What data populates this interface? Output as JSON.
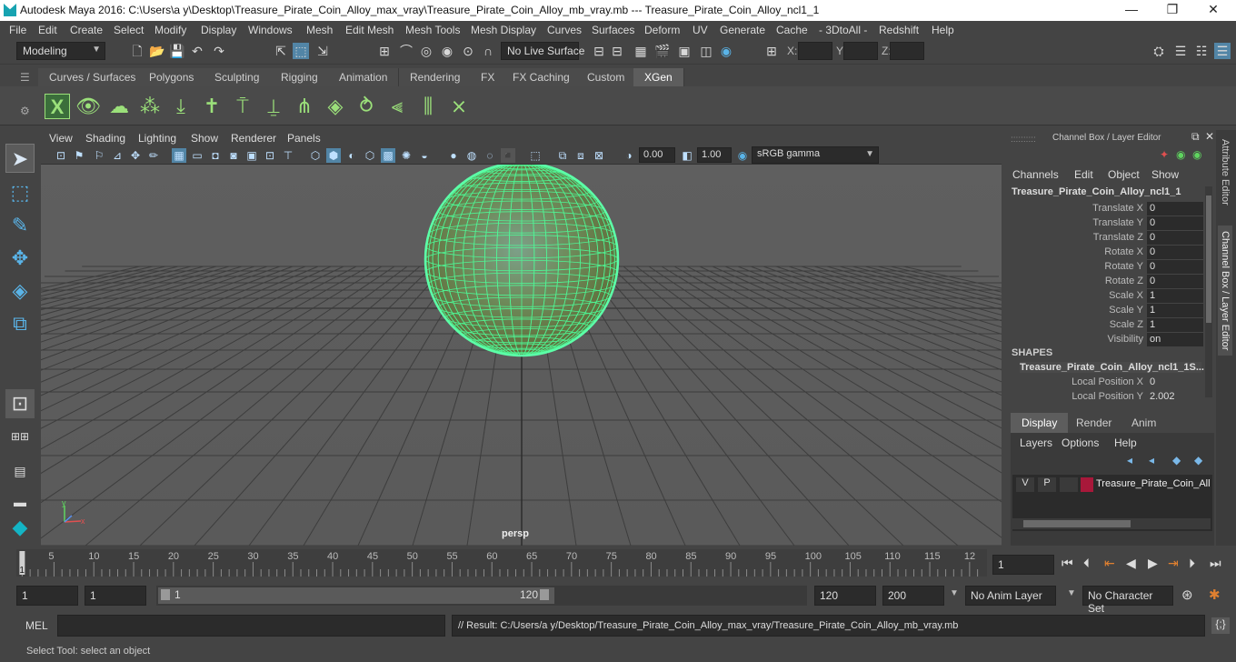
{
  "window": {
    "title": "Autodesk Maya 2016: C:\\Users\\a y\\Desktop\\Treasure_Pirate_Coin_Alloy_max_vray\\Treasure_Pirate_Coin_Alloy_mb_vray.mb   ---   Treasure_Pirate_Coin_Alloy_ncl1_1",
    "minimize": "—",
    "maximize": "❐",
    "close": "✕"
  },
  "menu": [
    "File",
    "Edit",
    "Create",
    "Select",
    "Modify",
    "Display",
    "Windows",
    "Mesh",
    "Edit Mesh",
    "Mesh Tools",
    "Mesh Display",
    "Curves",
    "Surfaces",
    "Deform",
    "UV",
    "Generate",
    "Cache",
    "- 3DtoAll -",
    "Redshift",
    "Help"
  ],
  "status": {
    "mode": "Modeling",
    "live_surface": "No Live Surface",
    "x_label": "X:",
    "y_label": "Y:",
    "z_label": "Z:"
  },
  "shelf_tabs": [
    "Curves / Surfaces",
    "Polygons",
    "Sculpting",
    "Rigging",
    "Animation",
    "Rendering",
    "FX",
    "FX Caching",
    "Custom",
    "XGen"
  ],
  "panel_menu": [
    "View",
    "Shading",
    "Lighting",
    "Show",
    "Renderer",
    "Panels"
  ],
  "panel_toolbar": {
    "exposure": "0.00",
    "gamma": "1.00",
    "colorspace": "sRGB gamma"
  },
  "viewport": {
    "camera": "persp"
  },
  "channel_box": {
    "header": "Channel Box / Layer Editor",
    "menus": [
      "Channels",
      "Edit",
      "Object",
      "Show"
    ],
    "object_name": "Treasure_Pirate_Coin_Alloy_ncl1_1",
    "attributes": [
      {
        "label": "Translate X",
        "value": "0"
      },
      {
        "label": "Translate Y",
        "value": "0"
      },
      {
        "label": "Translate Z",
        "value": "0"
      },
      {
        "label": "Rotate X",
        "value": "0"
      },
      {
        "label": "Rotate Y",
        "value": "0"
      },
      {
        "label": "Rotate Z",
        "value": "0"
      },
      {
        "label": "Scale X",
        "value": "1"
      },
      {
        "label": "Scale Y",
        "value": "1"
      },
      {
        "label": "Scale Z",
        "value": "1"
      },
      {
        "label": "Visibility",
        "value": "on"
      }
    ],
    "shapes_label": "SHAPES",
    "shape_name": "Treasure_Pirate_Coin_Alloy_ncl1_1S...",
    "shape_attributes": [
      {
        "label": "Local Position X",
        "value": "0"
      },
      {
        "label": "Local Position Y",
        "value": "2.002"
      }
    ]
  },
  "side_tabs": {
    "attribute_editor": "Attribute Editor",
    "channel_box": "Channel Box / Layer Editor"
  },
  "layer_editor": {
    "tabs": [
      "Display",
      "Render",
      "Anim"
    ],
    "menus": [
      "Layers",
      "Options",
      "Help"
    ],
    "layer": {
      "v": "V",
      "p": "P",
      "name": "Treasure_Pirate_Coin_All",
      "color": "#a8183a"
    }
  },
  "timeline": {
    "ticks": [
      "5",
      "10",
      "15",
      "20",
      "25",
      "30",
      "35",
      "40",
      "45",
      "50",
      "55",
      "60",
      "65",
      "70",
      "75",
      "80",
      "85",
      "90",
      "95",
      "100",
      "105",
      "110",
      "115",
      "12"
    ],
    "current_frame_marker": "1",
    "current_frame": "1"
  },
  "range": {
    "start": "1",
    "playback_start": "1",
    "slider_start": "1",
    "slider_end": "120",
    "playback_end": "120",
    "end": "200",
    "anim_layer": "No Anim Layer",
    "character_set": "No Character Set"
  },
  "command": {
    "mel_label": "MEL",
    "result": "// Result: C:/Users/a y/Desktop/Treasure_Pirate_Coin_Alloy_max_vray/Treasure_Pirate_Coin_Alloy_mb_vray.mb"
  },
  "help_line": "Select Tool: select an object"
}
